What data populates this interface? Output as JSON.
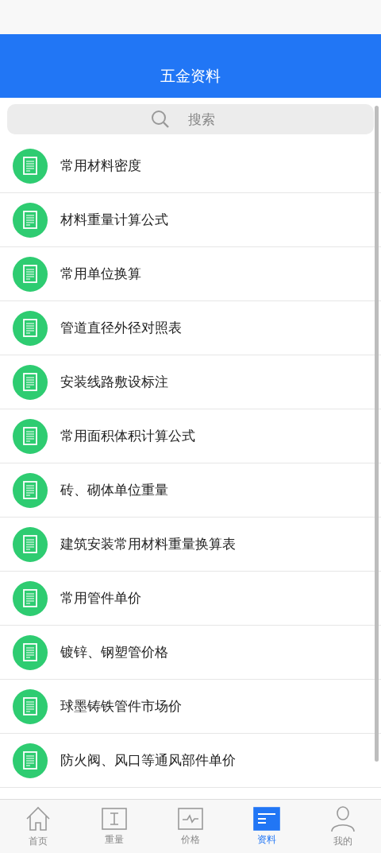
{
  "header": {
    "title": "五金资料"
  },
  "search": {
    "placeholder": "搜索"
  },
  "items": [
    {
      "label": "常用材料密度"
    },
    {
      "label": "材料重量计算公式"
    },
    {
      "label": "常用单位换算"
    },
    {
      "label": "管道直径外径对照表"
    },
    {
      "label": "安装线路敷设标注"
    },
    {
      "label": "常用面积体积计算公式"
    },
    {
      "label": "砖、砌体单位重量"
    },
    {
      "label": "建筑安装常用材料重量换算表"
    },
    {
      "label": "常用管件单价"
    },
    {
      "label": "镀锌、钢塑管价格"
    },
    {
      "label": "球墨铸铁管件市场价"
    },
    {
      "label": "防火阀、风口等通风部件单价"
    }
  ],
  "tab_bar": [
    {
      "label": "首页",
      "kind": "home",
      "selected": false
    },
    {
      "label": "重量",
      "kind": "weight",
      "selected": false
    },
    {
      "label": "价格",
      "kind": "price",
      "selected": false
    },
    {
      "label": "资料",
      "kind": "docs",
      "selected": true
    },
    {
      "label": "我的",
      "kind": "user",
      "selected": false
    }
  ]
}
